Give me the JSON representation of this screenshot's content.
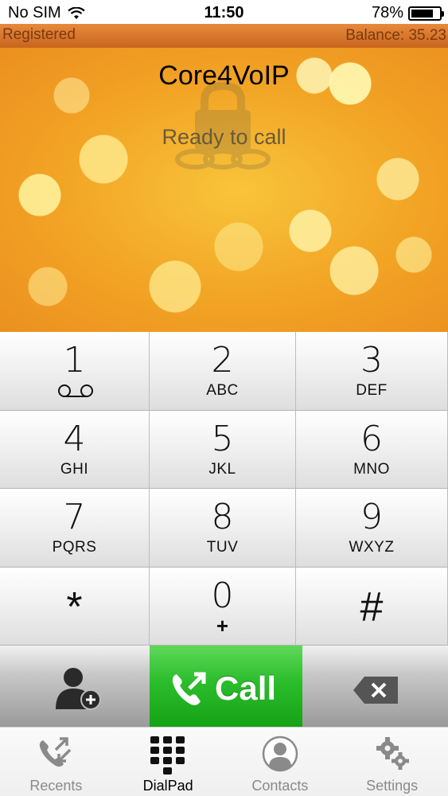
{
  "status_bar": {
    "carrier": "No SIM",
    "time": "11:50",
    "battery": "78%",
    "battery_level": 0.78
  },
  "registration": {
    "state": "Registered",
    "balance": "Balance: 35.23"
  },
  "header": {
    "title": "Core4VoIP",
    "status": "Ready to call"
  },
  "keypad": {
    "keys": [
      {
        "digit": "1",
        "letters": ""
      },
      {
        "digit": "2",
        "letters": "ABC"
      },
      {
        "digit": "3",
        "letters": "DEF"
      },
      {
        "digit": "4",
        "letters": "GHI"
      },
      {
        "digit": "5",
        "letters": "JKL"
      },
      {
        "digit": "6",
        "letters": "MNO"
      },
      {
        "digit": "7",
        "letters": "PQRS"
      },
      {
        "digit": "8",
        "letters": "TUV"
      },
      {
        "digit": "9",
        "letters": "WXYZ"
      },
      {
        "digit": "*",
        "letters": ""
      },
      {
        "digit": "0",
        "letters": "+"
      },
      {
        "digit": "#",
        "letters": ""
      }
    ]
  },
  "actions": {
    "call_label": "Call"
  },
  "tabs": [
    {
      "label": "Recents",
      "icon": "recents-icon"
    },
    {
      "label": "DialPad",
      "icon": "dialpad-icon"
    },
    {
      "label": "Contacts",
      "icon": "contacts-icon"
    },
    {
      "label": "Settings",
      "icon": "settings-icon"
    }
  ],
  "colors": {
    "accent_orange": "#d9732a",
    "call_green": "#2bbd2b"
  }
}
